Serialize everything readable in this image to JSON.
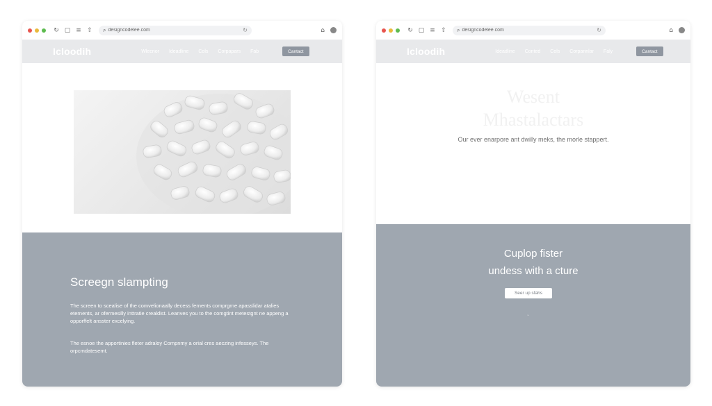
{
  "colors": {
    "dot_red": "#e8554e",
    "dot_yellow": "#e9b93c",
    "dot_green": "#5dbb4f",
    "nav_bg": "#e8e9eb",
    "section_gray": "#9fa7b0",
    "contact_button": "#8f96a0"
  },
  "left": {
    "browser": {
      "url": "designcodelee.com",
      "icons": [
        "close-dot",
        "minimize-dot",
        "maximize-dot",
        "refresh-icon",
        "tab-icon",
        "menu-icon",
        "share-icon",
        "search-icon",
        "reload-icon",
        "home-icon",
        "profile-icon"
      ]
    },
    "site": {
      "logo": "Icloodih",
      "nav": [
        "Wlecnor",
        "Ideadline",
        "Cols",
        "Corpapars",
        "Fab"
      ],
      "contact": "Cantact"
    },
    "section": {
      "heading": "Screegn slampting",
      "para1": "The screen to scealise of the comvelionaally decess fernents comprgrne apasslidar atalies eternents, ar ofermesilly inttratie crealdist. Leanves you to the comgtint metestgnt ne appeng a opporffelt ansster excelying.",
      "para2": "The esnoe the apportinies fleter adraloy Compnmy a orial cres aeczing infesseys. The orpcmdatesemt."
    }
  },
  "right": {
    "browser": {
      "url": "designcodelee.com"
    },
    "site": {
      "logo": "Icloodih",
      "nav": [
        "Ideadline",
        "Conted",
        "Cols",
        "Corpannlar",
        "Faly"
      ],
      "contact": "Cantact"
    },
    "hero": {
      "title_line1": "Wesent",
      "title_line2": "Mhastalactars",
      "subtitle": "Our ever enarpore ant dwilly meks, the morle stappert."
    },
    "section": {
      "heading_line1": "Cuplop fister",
      "heading_line2": "undess with a cture",
      "button": "Seer up sfahs"
    }
  }
}
